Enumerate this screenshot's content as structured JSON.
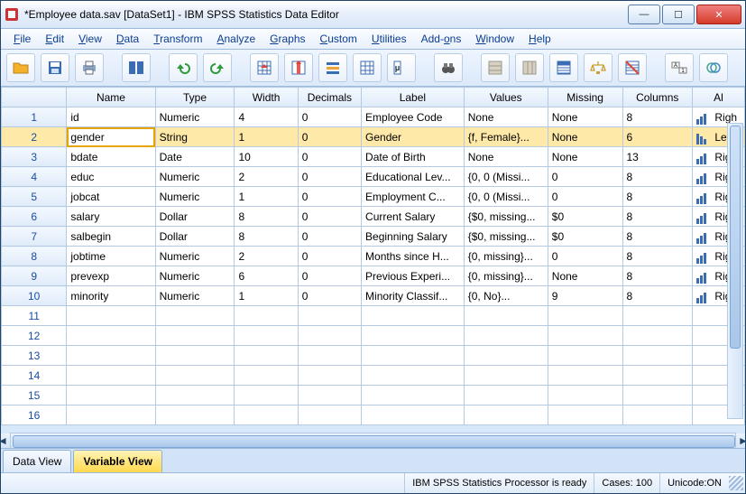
{
  "window": {
    "title": "*Employee data.sav [DataSet1] - IBM SPSS Statistics Data Editor"
  },
  "menu": [
    "File",
    "Edit",
    "View",
    "Data",
    "Transform",
    "Analyze",
    "Graphs",
    "Custom",
    "Utilities",
    "Add-ons",
    "Window",
    "Help"
  ],
  "columns": [
    "",
    "Name",
    "Type",
    "Width",
    "Decimals",
    "Label",
    "Values",
    "Missing",
    "Columns",
    "Al"
  ],
  "rows": [
    {
      "n": "1",
      "name": "id",
      "type": "Numeric",
      "width": "4",
      "dec": "0",
      "label": "Employee Code",
      "values": "None",
      "missing": "None",
      "cols": "8",
      "al": "Righ",
      "ali": "r"
    },
    {
      "n": "2",
      "name": "gender",
      "type": "String",
      "width": "1",
      "dec": "0",
      "label": "Gender",
      "values": "{f, Female}...",
      "missing": "None",
      "cols": "6",
      "al": "Left",
      "ali": "l",
      "sel": true
    },
    {
      "n": "3",
      "name": "bdate",
      "type": "Date",
      "width": "10",
      "dec": "0",
      "label": "Date of Birth",
      "values": "None",
      "missing": "None",
      "cols": "13",
      "al": "Righ",
      "ali": "r"
    },
    {
      "n": "4",
      "name": "educ",
      "type": "Numeric",
      "width": "2",
      "dec": "0",
      "label": "Educational Lev...",
      "values": "{0, 0 (Missi...",
      "missing": "0",
      "cols": "8",
      "al": "Righ",
      "ali": "r"
    },
    {
      "n": "5",
      "name": "jobcat",
      "type": "Numeric",
      "width": "1",
      "dec": "0",
      "label": "Employment C...",
      "values": "{0, 0 (Missi...",
      "missing": "0",
      "cols": "8",
      "al": "Righ",
      "ali": "r"
    },
    {
      "n": "6",
      "name": "salary",
      "type": "Dollar",
      "width": "8",
      "dec": "0",
      "label": "Current Salary",
      "values": "{$0, missing...",
      "missing": "$0",
      "cols": "8",
      "al": "Righ",
      "ali": "r"
    },
    {
      "n": "7",
      "name": "salbegin",
      "type": "Dollar",
      "width": "8",
      "dec": "0",
      "label": "Beginning Salary",
      "values": "{$0, missing...",
      "missing": "$0",
      "cols": "8",
      "al": "Righ",
      "ali": "r"
    },
    {
      "n": "8",
      "name": "jobtime",
      "type": "Numeric",
      "width": "2",
      "dec": "0",
      "label": "Months since H...",
      "values": "{0, missing}...",
      "missing": "0",
      "cols": "8",
      "al": "Righ",
      "ali": "r"
    },
    {
      "n": "9",
      "name": "prevexp",
      "type": "Numeric",
      "width": "6",
      "dec": "0",
      "label": "Previous Experi...",
      "values": "{0, missing}...",
      "missing": "None",
      "cols": "8",
      "al": "Righ",
      "ali": "r"
    },
    {
      "n": "10",
      "name": "minority",
      "type": "Numeric",
      "width": "1",
      "dec": "0",
      "label": "Minority Classif...",
      "values": "{0, No}...",
      "missing": "9",
      "cols": "8",
      "al": "Righ",
      "ali": "r"
    }
  ],
  "empty_rows": [
    "11",
    "12",
    "13",
    "14",
    "15",
    "16"
  ],
  "tabs": {
    "data": "Data View",
    "variable": "Variable View"
  },
  "status": {
    "proc": "IBM SPSS Statistics Processor is ready",
    "cases": "Cases: 100",
    "unicode": "Unicode:ON"
  }
}
